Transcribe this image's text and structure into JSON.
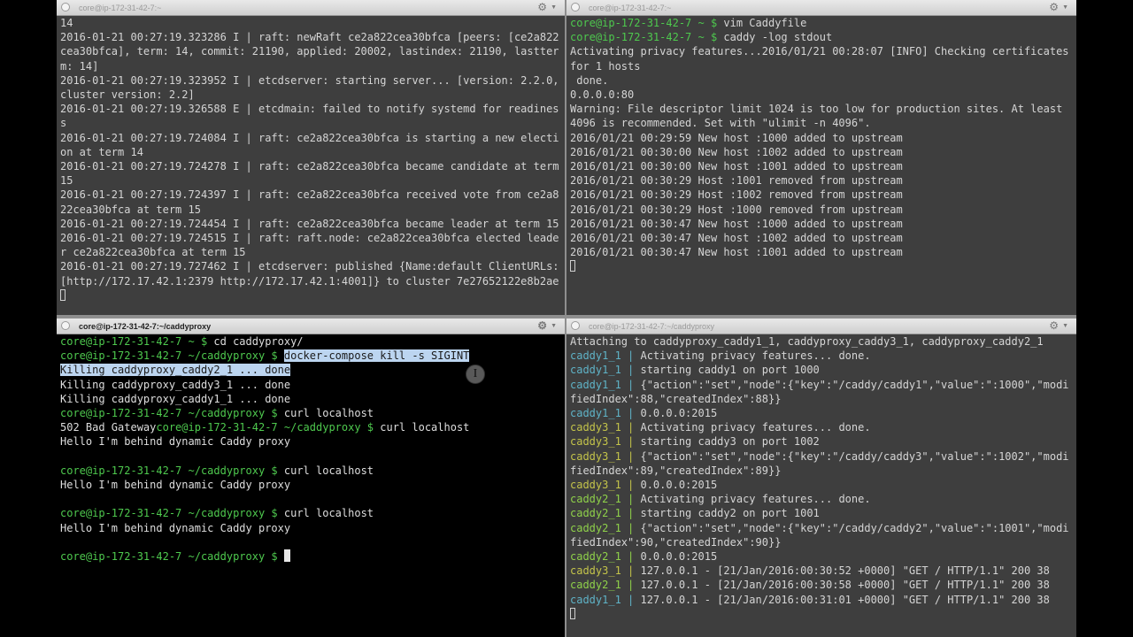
{
  "colors": {
    "prompt": "#4ec94e",
    "caddy1": "#5fb3c7",
    "caddy2": "#8fd14a",
    "caddy3": "#c4c44a",
    "selection": "#bcd5f0"
  },
  "panes": {
    "top_left": {
      "title": "core@ip-172-31-42-7:~",
      "lines": [
        {
          "t": "14"
        },
        {
          "t": "2016-01-21 00:27:19.323286 I | raft: newRaft ce2a822cea30bfca [peers: [ce2a822cea30bfca], term: 14, commit: 21190, applied: 20002, lastindex: 21190, lastterm: 14]"
        },
        {
          "t": "2016-01-21 00:27:19.323952 I | etcdserver: starting server... [version: 2.2.0, cluster version: 2.2]"
        },
        {
          "t": "2016-01-21 00:27:19.326588 E | etcdmain: failed to notify systemd for readiness"
        },
        {
          "t": "2016-01-21 00:27:19.724084 I | raft: ce2a822cea30bfca is starting a new election at term 14"
        },
        {
          "t": "2016-01-21 00:27:19.724278 I | raft: ce2a822cea30bfca became candidate at term 15"
        },
        {
          "t": "2016-01-21 00:27:19.724397 I | raft: ce2a822cea30bfca received vote from ce2a822cea30bfca at term 15"
        },
        {
          "t": "2016-01-21 00:27:19.724454 I | raft: ce2a822cea30bfca became leader at term 15"
        },
        {
          "t": "2016-01-21 00:27:19.724515 I | raft: raft.node: ce2a822cea30bfca elected leader ce2a822cea30bfca at term 15"
        },
        {
          "t": "2016-01-21 00:27:19.727462 I | etcdserver: published {Name:default ClientURLs:[http://172.17.42.1:2379 http://172.17.42.1:4001]} to cluster 7e27652122e8b2ae"
        }
      ]
    },
    "top_right": {
      "title": "core@ip-172-31-42-7:~",
      "lines": [
        {
          "p": "core@ip-172-31-42-7 ~ $ ",
          "t": "vim Caddyfile"
        },
        {
          "p": "core@ip-172-31-42-7 ~ $ ",
          "t": "caddy -log stdout"
        },
        {
          "t": "Activating privacy features...2016/01/21 00:28:07 [INFO] Checking certificates for 1 hosts"
        },
        {
          "t": " done."
        },
        {
          "t": "0.0.0.0:80"
        },
        {
          "t": "Warning: File descriptor limit 1024 is too low for production sites. At least 4096 is recommended. Set with \"ulimit -n 4096\"."
        },
        {
          "t": "2016/01/21 00:29:59 New host :1000 added to upstream"
        },
        {
          "t": "2016/01/21 00:30:00 New host :1002 added to upstream"
        },
        {
          "t": "2016/01/21 00:30:00 New host :1001 added to upstream"
        },
        {
          "t": "2016/01/21 00:30:29 Host :1001 removed from upstream"
        },
        {
          "t": "2016/01/21 00:30:29 Host :1002 removed from upstream"
        },
        {
          "t": "2016/01/21 00:30:29 Host :1000 removed from upstream"
        },
        {
          "t": "2016/01/21 00:30:47 New host :1000 added to upstream"
        },
        {
          "t": "2016/01/21 00:30:47 New host :1002 added to upstream"
        },
        {
          "t": "2016/01/21 00:30:47 New host :1001 added to upstream"
        }
      ]
    },
    "bottom_left": {
      "title": "core@ip-172-31-42-7:~/caddyproxy",
      "lines": [
        {
          "p": "core@ip-172-31-42-7 ~ $ ",
          "t": "cd caddyproxy/"
        },
        {
          "p": "core@ip-172-31-42-7 ~/caddyproxy $ ",
          "s": "docker-compose kill -s SIGINT"
        },
        {
          "s": "Killing caddyproxy_caddy2_1 ... done"
        },
        {
          "t": "Killing caddyproxy_caddy3_1 ... done"
        },
        {
          "t": "Killing caddyproxy_caddy1_1 ... done"
        },
        {
          "p": "core@ip-172-31-42-7 ~/caddyproxy $ ",
          "t": "curl localhost"
        },
        {
          "t": "502 Bad Gateway",
          "p2": "core@ip-172-31-42-7 ~/caddyproxy $ ",
          "t2": "curl localhost"
        },
        {
          "t": "Hello I'm behind dynamic Caddy proxy"
        },
        {
          "t": ""
        },
        {
          "p": "core@ip-172-31-42-7 ~/caddyproxy $ ",
          "t": "curl localhost"
        },
        {
          "t": "Hello I'm behind dynamic Caddy proxy"
        },
        {
          "t": ""
        },
        {
          "p": "core@ip-172-31-42-7 ~/caddyproxy $ ",
          "t": "curl localhost"
        },
        {
          "t": "Hello I'm behind dynamic Caddy proxy"
        },
        {
          "t": ""
        },
        {
          "p": "core@ip-172-31-42-7 ~/caddyproxy $ ",
          "cursor": true
        }
      ]
    },
    "bottom_right": {
      "title": "core@ip-172-31-42-7:~/caddyproxy",
      "lines": [
        {
          "t": "Attaching to caddyproxy_caddy1_1, caddyproxy_caddy3_1, caddyproxy_caddy2_1"
        },
        {
          "svc": "caddy1_1",
          "t": "Activating privacy features... done."
        },
        {
          "svc": "caddy1_1",
          "t": "starting caddy1 on port 1000"
        },
        {
          "svc": "caddy1_1",
          "t": "{\"action\":\"set\",\"node\":{\"key\":\"/caddy/caddy1\",\"value\":\":1000\",\"modifiedIndex\":88,\"createdIndex\":88}}"
        },
        {
          "svc": "caddy1_1",
          "t": "0.0.0.0:2015"
        },
        {
          "svc": "caddy3_1",
          "t": "Activating privacy features... done."
        },
        {
          "svc": "caddy3_1",
          "t": "starting caddy3 on port 1002"
        },
        {
          "svc": "caddy3_1",
          "t": "{\"action\":\"set\",\"node\":{\"key\":\"/caddy/caddy3\",\"value\":\":1002\",\"modifiedIndex\":89,\"createdIndex\":89}}"
        },
        {
          "svc": "caddy3_1",
          "t": "0.0.0.0:2015"
        },
        {
          "svc": "caddy2_1",
          "t": "Activating privacy features... done."
        },
        {
          "svc": "caddy2_1",
          "t": "starting caddy2 on port 1001"
        },
        {
          "svc": "caddy2_1",
          "t": "{\"action\":\"set\",\"node\":{\"key\":\"/caddy/caddy2\",\"value\":\":1001\",\"modifiedIndex\":90,\"createdIndex\":90}}"
        },
        {
          "svc": "caddy2_1",
          "t": "0.0.0.0:2015"
        },
        {
          "svc": "caddy3_1",
          "t": "127.0.0.1 - [21/Jan/2016:00:30:52 +0000] \"GET / HTTP/1.1\" 200 38"
        },
        {
          "svc": "caddy2_1",
          "t": "127.0.0.1 - [21/Jan/2016:00:30:58 +0000] \"GET / HTTP/1.1\" 200 38"
        },
        {
          "svc": "caddy1_1",
          "t": "127.0.0.1 - [21/Jan/2016:00:31:01 +0000] \"GET / HTTP/1.1\" 200 38"
        }
      ]
    }
  }
}
